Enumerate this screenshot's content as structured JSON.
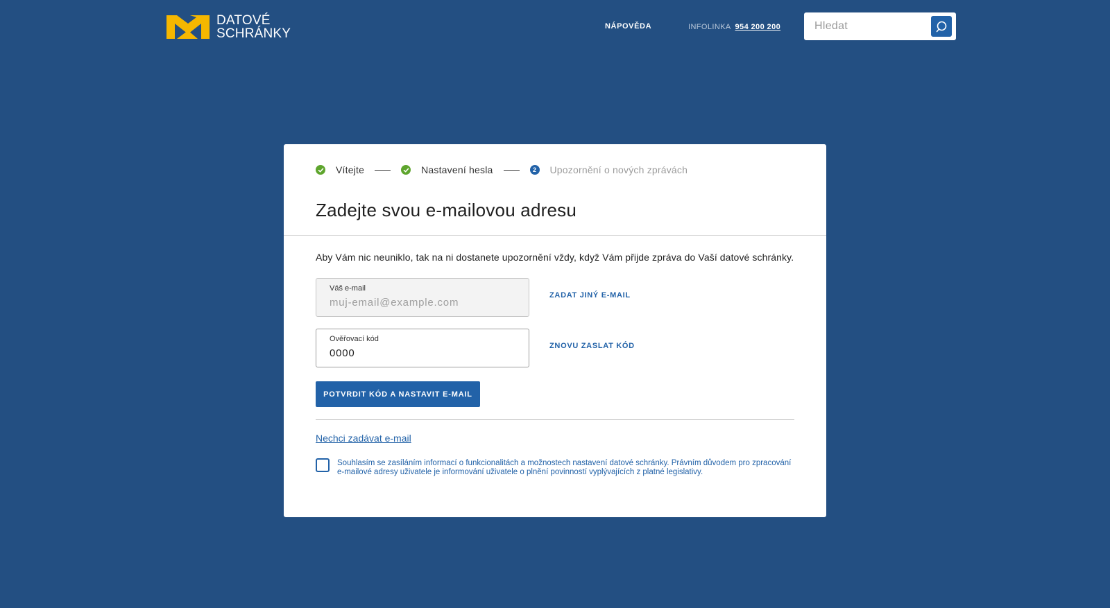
{
  "header": {
    "logo": {
      "line1": "DATOVÉ",
      "line2": "SCHRÁNKY",
      "accent_color": "#f5b700"
    },
    "help_label": "NÁPOVĚDA",
    "infoline_label": "INFOLINKA",
    "infoline_number": "954 200 200",
    "search": {
      "placeholder": "Hledat",
      "icon": "search-icon"
    }
  },
  "steps": [
    {
      "label": "Vítejte",
      "state": "done",
      "icon": "check-icon"
    },
    {
      "label": "Nastavení hesla",
      "state": "done",
      "icon": "check-icon"
    },
    {
      "number": "2",
      "label": "Upozornění o nových zprávách",
      "state": "current"
    }
  ],
  "form": {
    "title": "Zadejte svou e-mailovou adresu",
    "intro": "Aby Vám nic neuniklo, tak na ni dostanete upozornění vždy, když Vám přijde zpráva do Vaší datové schránky.",
    "email": {
      "label": "Váš e-mail",
      "placeholder": "muj-email@example.com",
      "value": ""
    },
    "email_action": "ZADAT JINÝ E-MAIL",
    "code": {
      "label": "Ověřovací kód",
      "value": "0000"
    },
    "code_action": "ZNOVU ZASLAT KÓD",
    "submit_label": "POTVRDIT KÓD A NASTAVIT E-MAIL",
    "skip_link": "Nechci zadávat e-mail",
    "consent_text": "Souhlasím se zasíláním informací o funkcionalitách a možnostech nastavení datové schránky. Právním důvodem pro zpracování e-mailové adresy uživatele je informování uživatele o plnění povinností vyplývajících z platné legislativy.",
    "consent_checked": false
  },
  "colors": {
    "background": "#234f82",
    "primary": "#2262a8",
    "success": "#5ea52d",
    "logo_accent": "#f5b700"
  }
}
